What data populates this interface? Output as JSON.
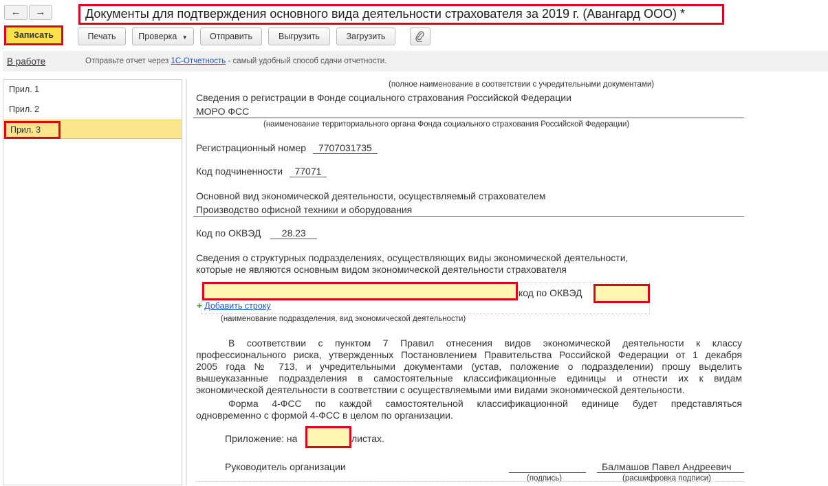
{
  "window": {
    "title": "Документы для подтверждения основного вида деятельности страхователя за 2019 г. (Авангард ООО) *",
    "back_icon": "arrow-left-icon",
    "forward_icon": "arrow-right-icon"
  },
  "toolbar": {
    "save_label": "Записать",
    "print_label": "Печать",
    "check_label": "Проверка",
    "send_label": "Отправить",
    "export_label": "Выгрузить",
    "import_label": "Загрузить",
    "attach_icon": "paperclip-icon"
  },
  "status": {
    "link_label": "В работе",
    "hint_prefix": "Отправьте отчет через",
    "hint_link": "1С-Отчетность",
    "hint_suffix": "- самый удобный способ сдачи отчетности."
  },
  "sidebar": {
    "items": [
      {
        "label": "Прил. 1"
      },
      {
        "label": "Прил. 2"
      },
      {
        "label": "Прил. 3",
        "selected": true
      }
    ]
  },
  "document": {
    "caption_fullname": "(полное наименование в соответствии с учредительными документами)",
    "fss_reg_heading": "Сведения о регистрации в Фонде социального страхования Российской Федерации",
    "fss_body": "МОРО ФСС",
    "caption_fss_body": "(наименование территориального органа Фонда социального страхования Российской Федерации)",
    "reg_number_label": "Регистрационный номер",
    "reg_number": "7707031735",
    "subordination_label": "Код подчиненности",
    "subordination_code": "77071",
    "main_activity_label": "Основной вид экономической деятельности, осуществляемый страхователем",
    "main_activity": "Производство офисной техники и оборудования",
    "okved_label": "Код по ОКВЭД",
    "okved": "28.23",
    "subdivisions_heading_1": "Сведения о структурных подразделениях, осуществляющих виды экономической деятельности,",
    "subdivisions_heading_2": "которые не являются основным видом экономической деятельности страхователя",
    "subdivision_okved_label": "код по ОКВЭД",
    "add_row_label": "Добавить строку",
    "add_icon": "plus-icon",
    "caption_subdivision": "(наименование подразделения, вид экономической деятельности)",
    "paragraph_lines": [
      "В соответствии с пунктом 7 Правил отнесения видов экономической деятельности к классу",
      "профессионального риска, утвержденных Постановлением Правительства Российской Федерации от 1 декабря",
      "2005 года № 713, и учредительными документами (устав, положение о подразделении) прошу выделить",
      "вышеуказанные подразделения в самостоятельные классификационные единицы и отнести их к видам",
      "экономической деятельности в соответствии с осуществляемыми ими видами экономической деятельности."
    ],
    "paragraph2_lines": [
      "Форма 4-ФСС по каждой самостоятельной классификационной единице будет представляться",
      "одновременно с формой 4-ФСС в целом по организации."
    ],
    "attachment_prefix": "Приложение: на",
    "attachment_suffix": "листах.",
    "head_label": "Руководитель организации",
    "head_name": "Балмашов Павел Андреевич",
    "caption_signature": "(подпись)",
    "caption_decoding": "(расшифровка подписи)"
  }
}
